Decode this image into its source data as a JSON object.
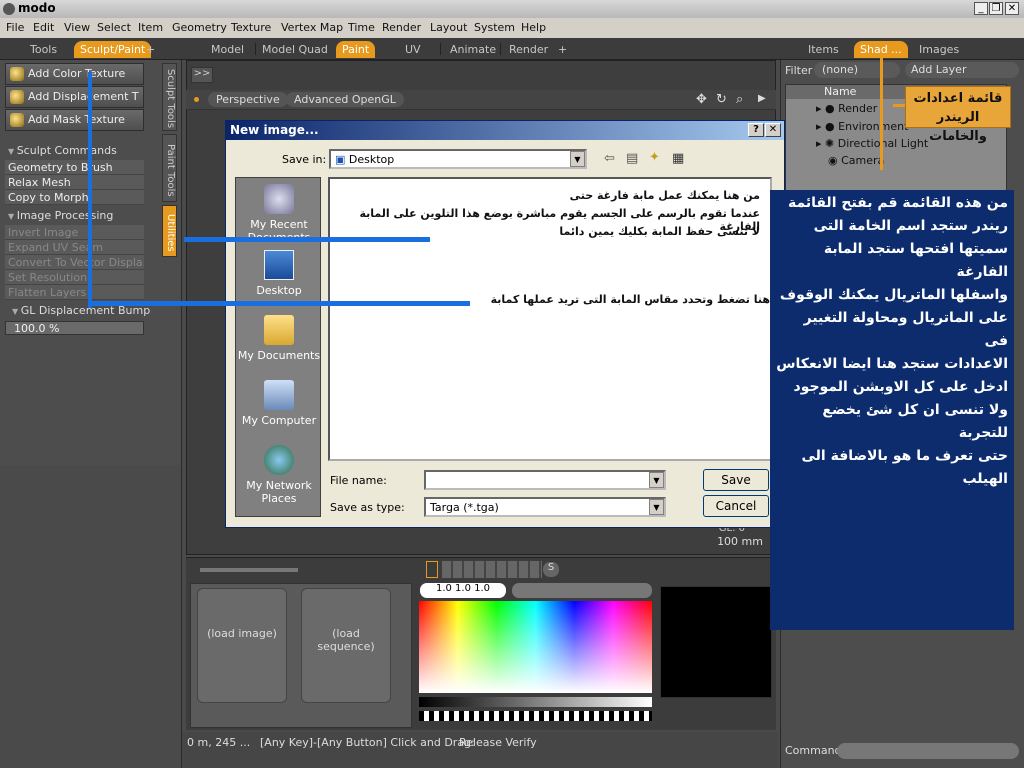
{
  "window": {
    "title": "modo",
    "min": "_",
    "max": "❐",
    "close": "✕"
  },
  "menu": [
    "File",
    "Edit",
    "View",
    "Select",
    "Item",
    "Geometry",
    "Texture",
    "Vertex Map",
    "Time",
    "Render",
    "Layout",
    "System",
    "Help"
  ],
  "left_tabs": {
    "tools": "Tools",
    "sculpt_paint": "Sculpt/Paint",
    "add": "+"
  },
  "center_tabs": {
    "model": "Model",
    "model_quad": "Model Quad",
    "paint": "Paint",
    "uv": "UV",
    "animate": "Animate",
    "render": "Render",
    "add": "+"
  },
  "right_tabs": {
    "items": "Items",
    "shader": "Shad ...",
    "images": "Images"
  },
  "left_panel": {
    "buttons": [
      "Add Color Texture",
      "Add Displacement T ...",
      "Add Mask Texture"
    ],
    "sculpt_commands_title": "Sculpt Commands",
    "sculpt_commands": [
      "Geometry to Brush",
      "Relax Mesh",
      "Copy to Morph"
    ],
    "image_processing_title": "Image Processing",
    "image_processing": [
      "Invert Image",
      "Expand UV Seam",
      "Convert To Vector Displa...",
      "Set Resolution",
      "Flatten Layers"
    ],
    "gl_bump_title": "GL Displacement Bump",
    "gl_bump_value": "100.0 %",
    "vtabs": [
      "Sculpt Tools",
      "Paint Tools",
      "Utilities"
    ]
  },
  "viewport": {
    "expand": ">>",
    "view": "Perspective",
    "shading": "Advanced OpenGL",
    "gl": "GL: 0",
    "scale": "100 mm"
  },
  "bottom": {
    "load_image": "(load image)",
    "load_sequence": "(load sequence)",
    "rgb_value": "1.0  1.0  1.0",
    "s_btn": "S"
  },
  "status": {
    "coords": "0 m, 245 ...",
    "hint": "[Any Key]-[Any Button] Click and Drag:",
    "verify": "Release Verify"
  },
  "right_panel": {
    "filter_label": "Filter",
    "filter_value": "(none)",
    "add_layer": "Add Layer",
    "name_col": "Name",
    "items": [
      "Render",
      "Environment",
      "Directional Light",
      "Camera"
    ],
    "command_label": "Command"
  },
  "dialog": {
    "title": "New image...",
    "help": "?",
    "close": "✕",
    "save_in_label": "Save in:",
    "save_in_value": "Desktop",
    "places": [
      "My Recent Documents",
      "Desktop",
      "My Documents",
      "My Computer",
      "My Network Places"
    ],
    "file_name_label": "File name:",
    "file_name_value": "",
    "save_as_type_label": "Save as type:",
    "save_as_type_value": "Targa (*.tga)",
    "save_btn": "Save",
    "cancel_btn": "Cancel"
  },
  "annotations": {
    "dialog_lines": [
      "من هنا يمكنك عمل مابة فارغة حتى",
      "عندما تقوم بالرسم على الجسم يقوم مباشرة بوضع هذا التلوين على المابة الفارغة",
      "لا تنسى حفظ المابة بكليك يمين دائما"
    ],
    "dialog_size_note": "هنا تضغط وتحدد مقاس المابة التى تريد عملها كمابة",
    "shader_label": "قائمة اعدادات الريندر والخامات",
    "side_note": [
      "من هذه القائمة قم بفتح القائمة",
      "ريندر ستجد اسم الخامة التى",
      "سميتها افتحها ستجد المابة الفارغة",
      "واسفلها الماتريال يمكنك الوقوف",
      "على الماتريال ومحاولة التغيير فى",
      "الاعدادات ستجد هنا ايضا الانعكاس",
      "ادخل على كل الاوبشن الموجود",
      "ولا تنسى ان كل شئ يخضع للتجربة",
      "حتى تعرف ما هو بالاضافة الى الهيلب"
    ]
  },
  "colors": {
    "accent": "#e89a1e",
    "annot_bg": "#0c2c6e",
    "annot_line": "#1a6fe0"
  }
}
